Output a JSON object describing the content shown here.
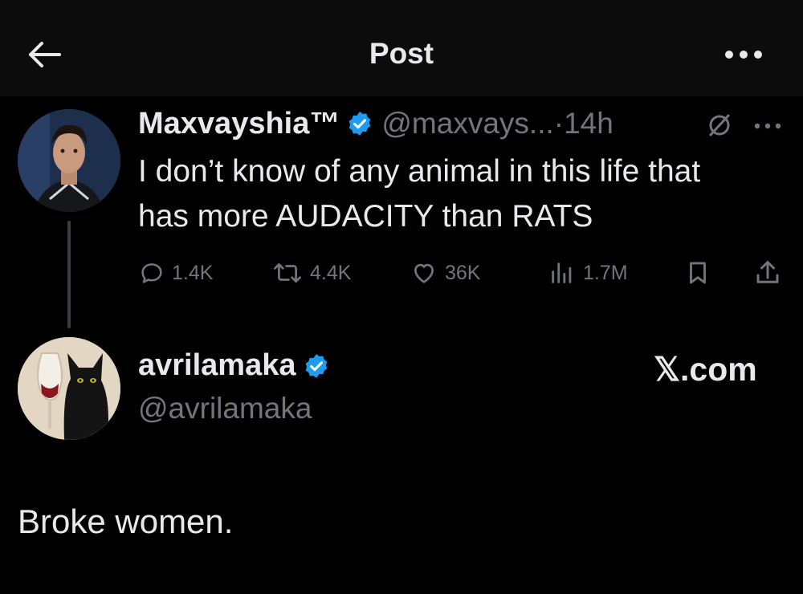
{
  "header": {
    "title": "Post"
  },
  "post": {
    "author_name": "Maxvayshia™",
    "author_handle": "@maxvays...",
    "time": "·14h",
    "text_line1": "I don’t know of any animal in this life that",
    "text_line2": "has more AUDACITY than RATS",
    "replies": "1.4K",
    "reposts": "4.4K",
    "likes": "36K",
    "views": "1.7M"
  },
  "reply": {
    "author_name": "avrilamaka",
    "author_handle": "@avrilamaka",
    "brand": "𝕏.com",
    "text": "Broke women."
  },
  "colors": {
    "background": "#000000",
    "header_background": "#0c0c0c",
    "text_primary": "#e7e9ea",
    "text_secondary": "#71767b",
    "verified_blue": "#1d9bf0"
  },
  "icons": {
    "back": "arrow-left-icon",
    "more": "more-horizontal-icon",
    "verified": "verified-badge-icon",
    "muted": "mute-circle-icon",
    "reply": "comment-bubble-icon",
    "repost": "repost-icon",
    "like": "heart-icon",
    "views": "bar-chart-icon",
    "bookmark": "bookmark-icon",
    "share": "share-icon"
  }
}
